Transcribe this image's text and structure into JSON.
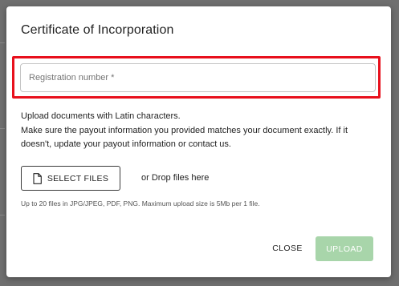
{
  "dialog": {
    "title": "Certificate of Incorporation",
    "registration_field": {
      "placeholder": "Registration number *",
      "value": ""
    },
    "info_lines": [
      "Upload documents with Latin characters.",
      "Make sure the payout information you provided matches your document exactly. If it doesn't, update your payout information or contact us."
    ],
    "select_files_label": "SELECT FILES",
    "select_files_icon": "file-icon",
    "drop_text": "or Drop files here",
    "hint": "Up to 20 files in JPG/JPEG, PDF, PNG. Maximum upload size is 5Mb per 1 file.",
    "close_label": "CLOSE",
    "upload_label": "UPLOAD"
  },
  "colors": {
    "highlight": "#e8101c",
    "upload_disabled": "#a8d5aa",
    "backdrop": "#6f6f6f"
  }
}
